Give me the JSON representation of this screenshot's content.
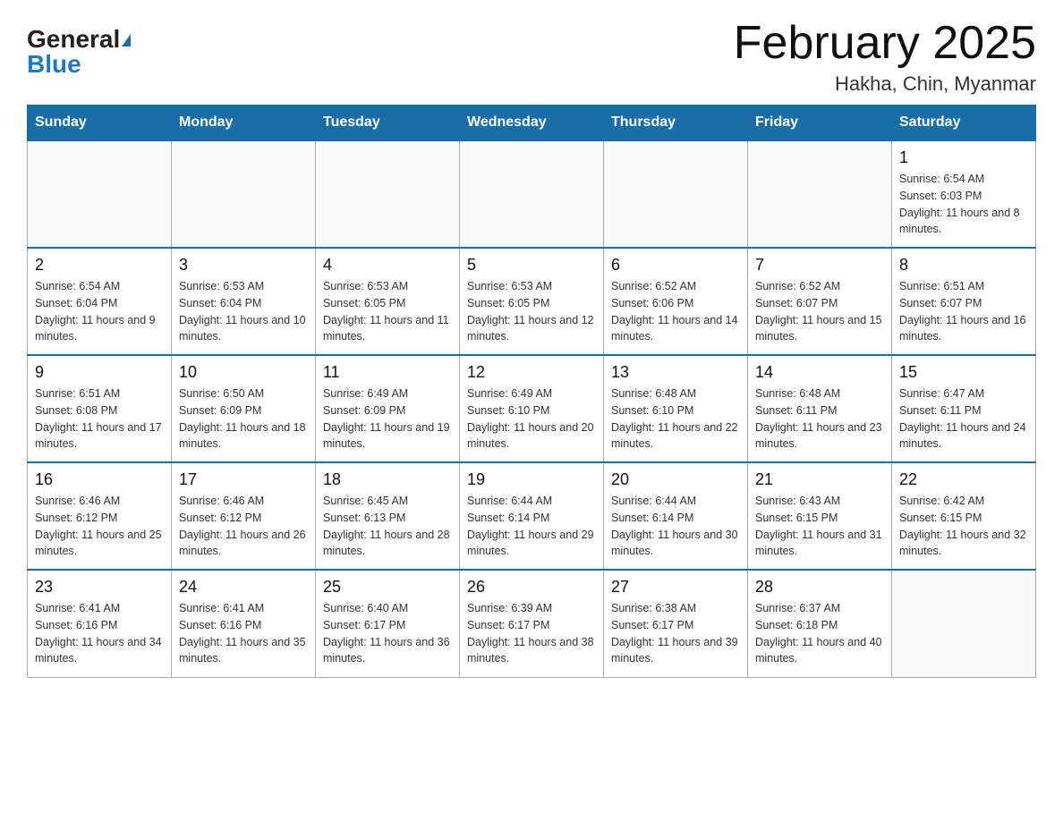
{
  "header": {
    "logo_general": "General",
    "logo_blue": "Blue",
    "month_title": "February 2025",
    "location": "Hakha, Chin, Myanmar"
  },
  "weekdays": [
    "Sunday",
    "Monday",
    "Tuesday",
    "Wednesday",
    "Thursday",
    "Friday",
    "Saturday"
  ],
  "weeks": [
    [
      {
        "day": "",
        "sunrise": "",
        "sunset": "",
        "daylight": "",
        "empty": true
      },
      {
        "day": "",
        "sunrise": "",
        "sunset": "",
        "daylight": "",
        "empty": true
      },
      {
        "day": "",
        "sunrise": "",
        "sunset": "",
        "daylight": "",
        "empty": true
      },
      {
        "day": "",
        "sunrise": "",
        "sunset": "",
        "daylight": "",
        "empty": true
      },
      {
        "day": "",
        "sunrise": "",
        "sunset": "",
        "daylight": "",
        "empty": true
      },
      {
        "day": "",
        "sunrise": "",
        "sunset": "",
        "daylight": "",
        "empty": true
      },
      {
        "day": "1",
        "sunrise": "Sunrise: 6:54 AM",
        "sunset": "Sunset: 6:03 PM",
        "daylight": "Daylight: 11 hours and 8 minutes.",
        "empty": false
      }
    ],
    [
      {
        "day": "2",
        "sunrise": "Sunrise: 6:54 AM",
        "sunset": "Sunset: 6:04 PM",
        "daylight": "Daylight: 11 hours and 9 minutes.",
        "empty": false
      },
      {
        "day": "3",
        "sunrise": "Sunrise: 6:53 AM",
        "sunset": "Sunset: 6:04 PM",
        "daylight": "Daylight: 11 hours and 10 minutes.",
        "empty": false
      },
      {
        "day": "4",
        "sunrise": "Sunrise: 6:53 AM",
        "sunset": "Sunset: 6:05 PM",
        "daylight": "Daylight: 11 hours and 11 minutes.",
        "empty": false
      },
      {
        "day": "5",
        "sunrise": "Sunrise: 6:53 AM",
        "sunset": "Sunset: 6:05 PM",
        "daylight": "Daylight: 11 hours and 12 minutes.",
        "empty": false
      },
      {
        "day": "6",
        "sunrise": "Sunrise: 6:52 AM",
        "sunset": "Sunset: 6:06 PM",
        "daylight": "Daylight: 11 hours and 14 minutes.",
        "empty": false
      },
      {
        "day": "7",
        "sunrise": "Sunrise: 6:52 AM",
        "sunset": "Sunset: 6:07 PM",
        "daylight": "Daylight: 11 hours and 15 minutes.",
        "empty": false
      },
      {
        "day": "8",
        "sunrise": "Sunrise: 6:51 AM",
        "sunset": "Sunset: 6:07 PM",
        "daylight": "Daylight: 11 hours and 16 minutes.",
        "empty": false
      }
    ],
    [
      {
        "day": "9",
        "sunrise": "Sunrise: 6:51 AM",
        "sunset": "Sunset: 6:08 PM",
        "daylight": "Daylight: 11 hours and 17 minutes.",
        "empty": false
      },
      {
        "day": "10",
        "sunrise": "Sunrise: 6:50 AM",
        "sunset": "Sunset: 6:09 PM",
        "daylight": "Daylight: 11 hours and 18 minutes.",
        "empty": false
      },
      {
        "day": "11",
        "sunrise": "Sunrise: 6:49 AM",
        "sunset": "Sunset: 6:09 PM",
        "daylight": "Daylight: 11 hours and 19 minutes.",
        "empty": false
      },
      {
        "day": "12",
        "sunrise": "Sunrise: 6:49 AM",
        "sunset": "Sunset: 6:10 PM",
        "daylight": "Daylight: 11 hours and 20 minutes.",
        "empty": false
      },
      {
        "day": "13",
        "sunrise": "Sunrise: 6:48 AM",
        "sunset": "Sunset: 6:10 PM",
        "daylight": "Daylight: 11 hours and 22 minutes.",
        "empty": false
      },
      {
        "day": "14",
        "sunrise": "Sunrise: 6:48 AM",
        "sunset": "Sunset: 6:11 PM",
        "daylight": "Daylight: 11 hours and 23 minutes.",
        "empty": false
      },
      {
        "day": "15",
        "sunrise": "Sunrise: 6:47 AM",
        "sunset": "Sunset: 6:11 PM",
        "daylight": "Daylight: 11 hours and 24 minutes.",
        "empty": false
      }
    ],
    [
      {
        "day": "16",
        "sunrise": "Sunrise: 6:46 AM",
        "sunset": "Sunset: 6:12 PM",
        "daylight": "Daylight: 11 hours and 25 minutes.",
        "empty": false
      },
      {
        "day": "17",
        "sunrise": "Sunrise: 6:46 AM",
        "sunset": "Sunset: 6:12 PM",
        "daylight": "Daylight: 11 hours and 26 minutes.",
        "empty": false
      },
      {
        "day": "18",
        "sunrise": "Sunrise: 6:45 AM",
        "sunset": "Sunset: 6:13 PM",
        "daylight": "Daylight: 11 hours and 28 minutes.",
        "empty": false
      },
      {
        "day": "19",
        "sunrise": "Sunrise: 6:44 AM",
        "sunset": "Sunset: 6:14 PM",
        "daylight": "Daylight: 11 hours and 29 minutes.",
        "empty": false
      },
      {
        "day": "20",
        "sunrise": "Sunrise: 6:44 AM",
        "sunset": "Sunset: 6:14 PM",
        "daylight": "Daylight: 11 hours and 30 minutes.",
        "empty": false
      },
      {
        "day": "21",
        "sunrise": "Sunrise: 6:43 AM",
        "sunset": "Sunset: 6:15 PM",
        "daylight": "Daylight: 11 hours and 31 minutes.",
        "empty": false
      },
      {
        "day": "22",
        "sunrise": "Sunrise: 6:42 AM",
        "sunset": "Sunset: 6:15 PM",
        "daylight": "Daylight: 11 hours and 32 minutes.",
        "empty": false
      }
    ],
    [
      {
        "day": "23",
        "sunrise": "Sunrise: 6:41 AM",
        "sunset": "Sunset: 6:16 PM",
        "daylight": "Daylight: 11 hours and 34 minutes.",
        "empty": false
      },
      {
        "day": "24",
        "sunrise": "Sunrise: 6:41 AM",
        "sunset": "Sunset: 6:16 PM",
        "daylight": "Daylight: 11 hours and 35 minutes.",
        "empty": false
      },
      {
        "day": "25",
        "sunrise": "Sunrise: 6:40 AM",
        "sunset": "Sunset: 6:17 PM",
        "daylight": "Daylight: 11 hours and 36 minutes.",
        "empty": false
      },
      {
        "day": "26",
        "sunrise": "Sunrise: 6:39 AM",
        "sunset": "Sunset: 6:17 PM",
        "daylight": "Daylight: 11 hours and 38 minutes.",
        "empty": false
      },
      {
        "day": "27",
        "sunrise": "Sunrise: 6:38 AM",
        "sunset": "Sunset: 6:17 PM",
        "daylight": "Daylight: 11 hours and 39 minutes.",
        "empty": false
      },
      {
        "day": "28",
        "sunrise": "Sunrise: 6:37 AM",
        "sunset": "Sunset: 6:18 PM",
        "daylight": "Daylight: 11 hours and 40 minutes.",
        "empty": false
      },
      {
        "day": "",
        "sunrise": "",
        "sunset": "",
        "daylight": "",
        "empty": true
      }
    ]
  ]
}
